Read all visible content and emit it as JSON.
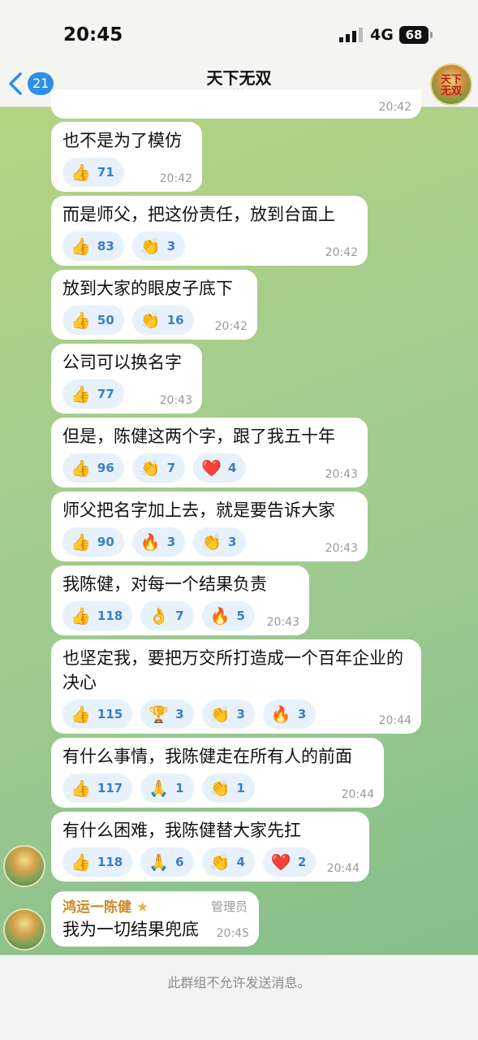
{
  "status_bar": {
    "time": "20:45",
    "network": "4G",
    "battery": "68"
  },
  "header": {
    "back_count": "21",
    "title": "天下无双",
    "subtitle": "群组",
    "avatar_text_1": "天下",
    "avatar_text_2": "无双"
  },
  "partial_top": {
    "time": "20:42"
  },
  "messages": [
    {
      "text": "也不是为了模仿",
      "time": "20:42",
      "reactions": [
        {
          "emoji": "👍",
          "count": "71"
        }
      ]
    },
    {
      "text": "而是师父，把这份责任，放到台面上",
      "time": "20:42",
      "reactions": [
        {
          "emoji": "👍",
          "count": "83"
        },
        {
          "emoji": "👏",
          "count": "3"
        }
      ]
    },
    {
      "text": "放到大家的眼皮子底下",
      "time": "20:42",
      "reactions": [
        {
          "emoji": "👍",
          "count": "50"
        },
        {
          "emoji": "👏",
          "count": "16"
        }
      ]
    },
    {
      "text": "公司可以换名字",
      "time": "20:43",
      "reactions": [
        {
          "emoji": "👍",
          "count": "77"
        }
      ]
    },
    {
      "text": "但是，陈健这两个字，跟了我五十年",
      "time": "20:43",
      "reactions": [
        {
          "emoji": "👍",
          "count": "96"
        },
        {
          "emoji": "👏",
          "count": "7"
        },
        {
          "emoji": "❤️",
          "count": "4"
        }
      ]
    },
    {
      "text": "师父把名字加上去，就是要告诉大家",
      "time": "20:43",
      "reactions": [
        {
          "emoji": "👍",
          "count": "90"
        },
        {
          "emoji": "🔥",
          "count": "3"
        },
        {
          "emoji": "👏",
          "count": "3"
        }
      ]
    },
    {
      "text": "我陈健，对每一个结果负责",
      "time": "20:43",
      "reactions": [
        {
          "emoji": "👍",
          "count": "118"
        },
        {
          "emoji": "👌",
          "count": "7"
        },
        {
          "emoji": "🔥",
          "count": "5"
        }
      ]
    },
    {
      "text": "也坚定我，要把万交所打造成一个百年企业的决心",
      "time": "20:44",
      "reactions": [
        {
          "emoji": "👍",
          "count": "115"
        },
        {
          "emoji": "🏆",
          "count": "3"
        },
        {
          "emoji": "👏",
          "count": "3"
        },
        {
          "emoji": "🔥",
          "count": "3"
        }
      ]
    },
    {
      "text": "有什么事情，我陈健走在所有人的前面",
      "time": "20:44",
      "reactions": [
        {
          "emoji": "👍",
          "count": "117"
        },
        {
          "emoji": "🙏",
          "count": "1"
        },
        {
          "emoji": "👏",
          "count": "1"
        }
      ]
    },
    {
      "text": "有什么困难，我陈健替大家先扛",
      "time": "20:44",
      "reactions": [
        {
          "emoji": "👍",
          "count": "118"
        },
        {
          "emoji": "🙏",
          "count": "6"
        },
        {
          "emoji": "👏",
          "count": "4"
        },
        {
          "emoji": "❤️",
          "count": "2"
        }
      ]
    }
  ],
  "last_message": {
    "sender": "鸿运一陈健",
    "role": "管理员",
    "text": "我为一切结果兜底",
    "time": "20:45"
  },
  "footer": {
    "notice": "此群组不允许发送消息。"
  }
}
